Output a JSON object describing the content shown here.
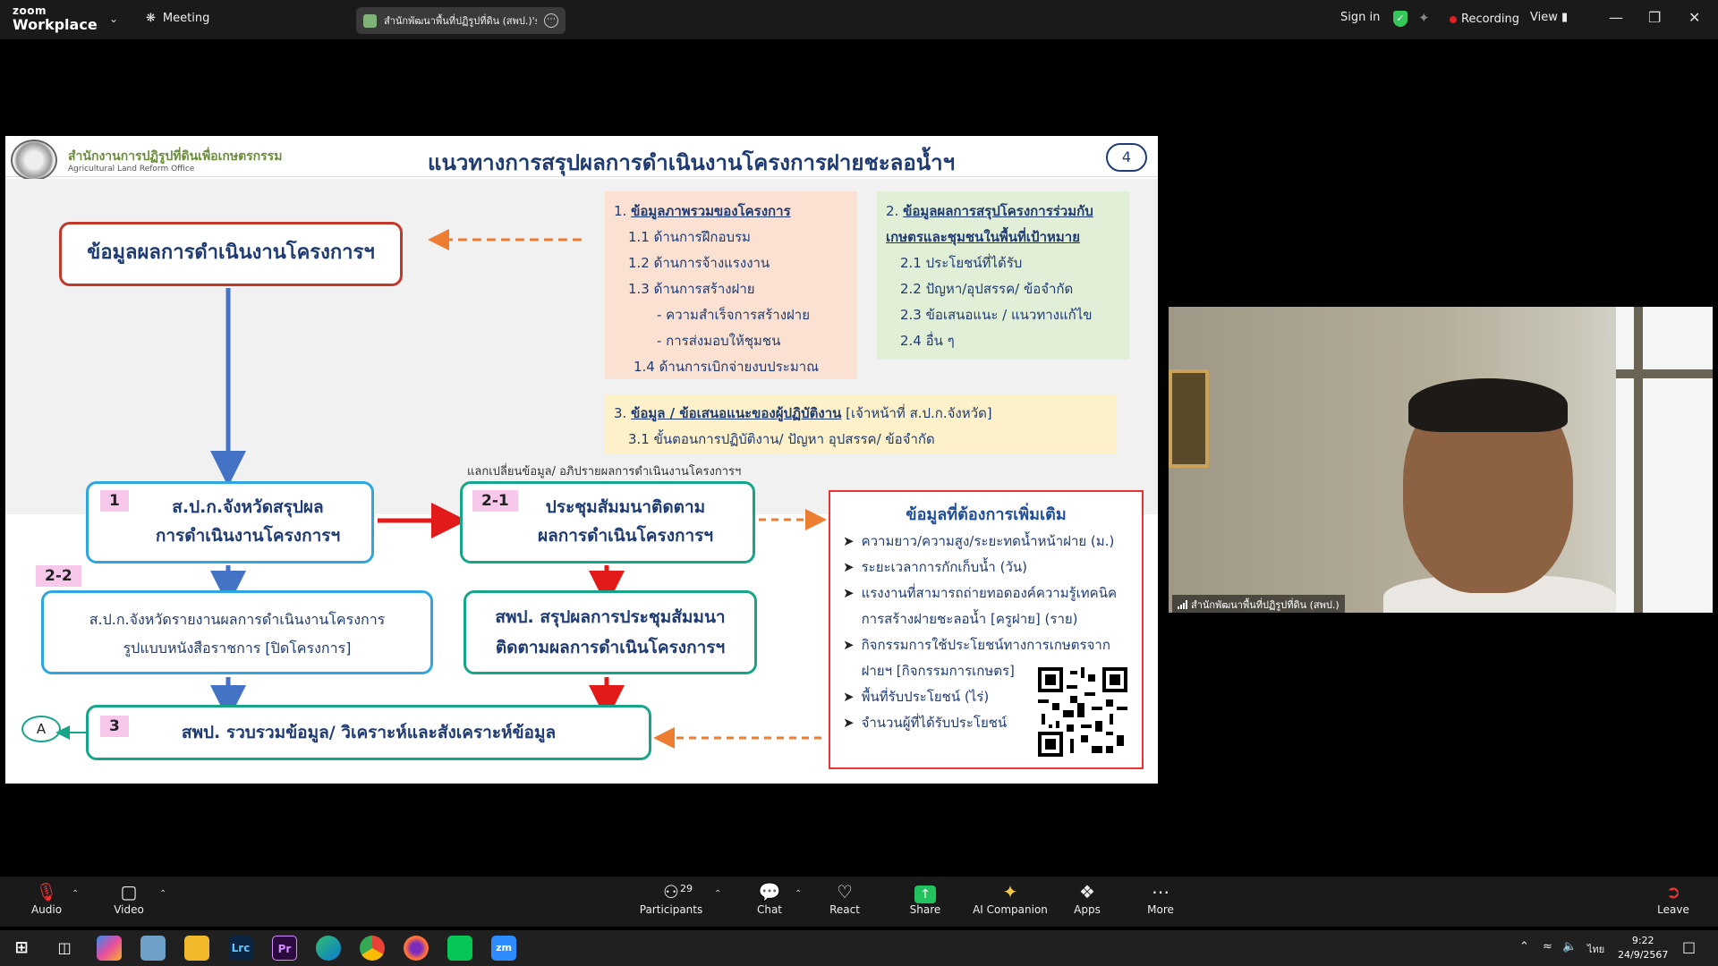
{
  "app": {
    "brand_top": "zoom",
    "brand_bottom": "Workplace",
    "meeting_label": "Meeting",
    "tab_title": "สำนักพัฒนาพื้นที่ปฏิรูปที่ดิน (สพป.)'s s",
    "sign_in": "Sign in",
    "recording": "Recording",
    "view": "View"
  },
  "slide": {
    "org_th": "สำนักงานการปฏิรูปที่ดินเพื่อเกษตรกรรม",
    "org_en": "Agricultural Land Reform Office",
    "title": "แนวทางการสรุปผลการดำเนินงานโครงการฝายชะลอน้ำฯ",
    "page_number": "4",
    "main_box": "ข้อมูลผลการดำเนินงานโครงการฯ",
    "info1": {
      "heading_num": "1.",
      "heading": "ข้อมูลภาพรวมของโครงการ",
      "items": [
        "1.1 ด้านการฝึกอบรม",
        "1.2 ด้านการจ้างแรงงาน",
        "1.3 ด้านการสร้างฝาย",
        "- ความสำเร็จการสร้างฝาย",
        "- การส่งมอบให้ชุมชน",
        "1.4 ด้านการเบิกจ่ายงบประมาณ"
      ]
    },
    "info2": {
      "heading_num": "2.",
      "heading": "ข้อมูลผลการสรุปโครงการร่วมกับเกษตรและชุมชนในพื้นที่เป้าหมาย",
      "items": [
        "2.1 ประโยชน์ที่ได้รับ",
        "2.2 ปัญหา/อุปสรรค/ ข้อจำกัด",
        "2.3 ข้อเสนอแนะ / แนวทางแก้ไข",
        "2.4 อื่น ๆ"
      ]
    },
    "info3": {
      "heading_num": "3.",
      "heading": "ข้อมูล / ข้อเสนอแนะของผู้ปฏิบัติงาน",
      "heading_suffix": "[เจ้าหน้าที่ ส.ป.ก.จังหวัด]",
      "item": "3.1 ขั้นตอนการปฏิบัติงาน/ ปัญหา อุปสรรค/ ข้อจำกัด"
    },
    "exchange_note": "แลกเปลี่ยนข้อมูล/ อภิปรายผลการดำเนินงานโครงการฯ",
    "step1": {
      "tag": "1",
      "line1": "ส.ป.ก.จังหวัดสรุปผล",
      "line2": "การดำเนินงานโครงการฯ"
    },
    "step21": {
      "tag": "2-1",
      "line1": "ประชุมสัมมนาติดตาม",
      "line2": "ผลการดำเนินโครงการฯ"
    },
    "step22": {
      "tag": "2-2",
      "line1": "ส.ป.ก.จังหวัดรายงานผลการดำเนินงานโครงการ",
      "line2": "รูปแบบหนังสือราชการ [ปิดโครงการ]"
    },
    "step_spp": {
      "line1": "สพป. สรุปผลการประชุมสัมมนา",
      "line2": "ติดตามผลการดำเนินโครงการฯ"
    },
    "step3": {
      "tag": "3",
      "text": "สพป. รวบรวมข้อมูล/ วิเคราะห์และสังเคราะห์ข้อมูล"
    },
    "circle_a": "A",
    "more": {
      "title": "ข้อมูลที่ต้องการเพิ่มเติม",
      "items": [
        "ความยาว/ความสูง/ระยะทดน้ำหน้าฝาย (ม.)",
        "ระยะเวลาการกักเก็บน้ำ (วัน)",
        "แรงงานที่สามารถถ่ายทอดองค์ความรู้เทคนิคการสร้างฝายชะลอน้ำ [ครูฝาย] (ราย)",
        "กิจกรรมการใช้ประโยชน์ทางการเกษตรจากฝายฯ [กิจกรรมการเกษตร]",
        "พื้นที่รับประโยชน์ (ไร่)",
        "จำนวนผู้ที่ได้รับประโยชน์"
      ]
    }
  },
  "video": {
    "participant_name": "สำนักพัฒนาพื้นที่ปฏิรูปที่ดิน (สพป.)"
  },
  "toolbar": {
    "audio": "Audio",
    "video": "Video",
    "participants": "Participants",
    "participant_count": "29",
    "chat": "Chat",
    "react": "React",
    "share": "Share",
    "ai_companion": "AI Companion",
    "apps": "Apps",
    "more": "More",
    "leave": "Leave"
  },
  "taskbar": {
    "lang": "ไทย",
    "time": "9:22",
    "date": "24/9/2567",
    "apps": [
      "Lrc",
      "Pr",
      "zm"
    ]
  },
  "colors": {
    "title_blue": "#1f3b73",
    "red_border": "#c0392b",
    "blue_border": "#2ea7e0",
    "teal_border": "#17a589",
    "arrow_blue": "#4472c4",
    "arrow_red": "#e21a1a",
    "arrow_orange": "#ed7d31",
    "tag_pink": "#f8c8ea"
  }
}
